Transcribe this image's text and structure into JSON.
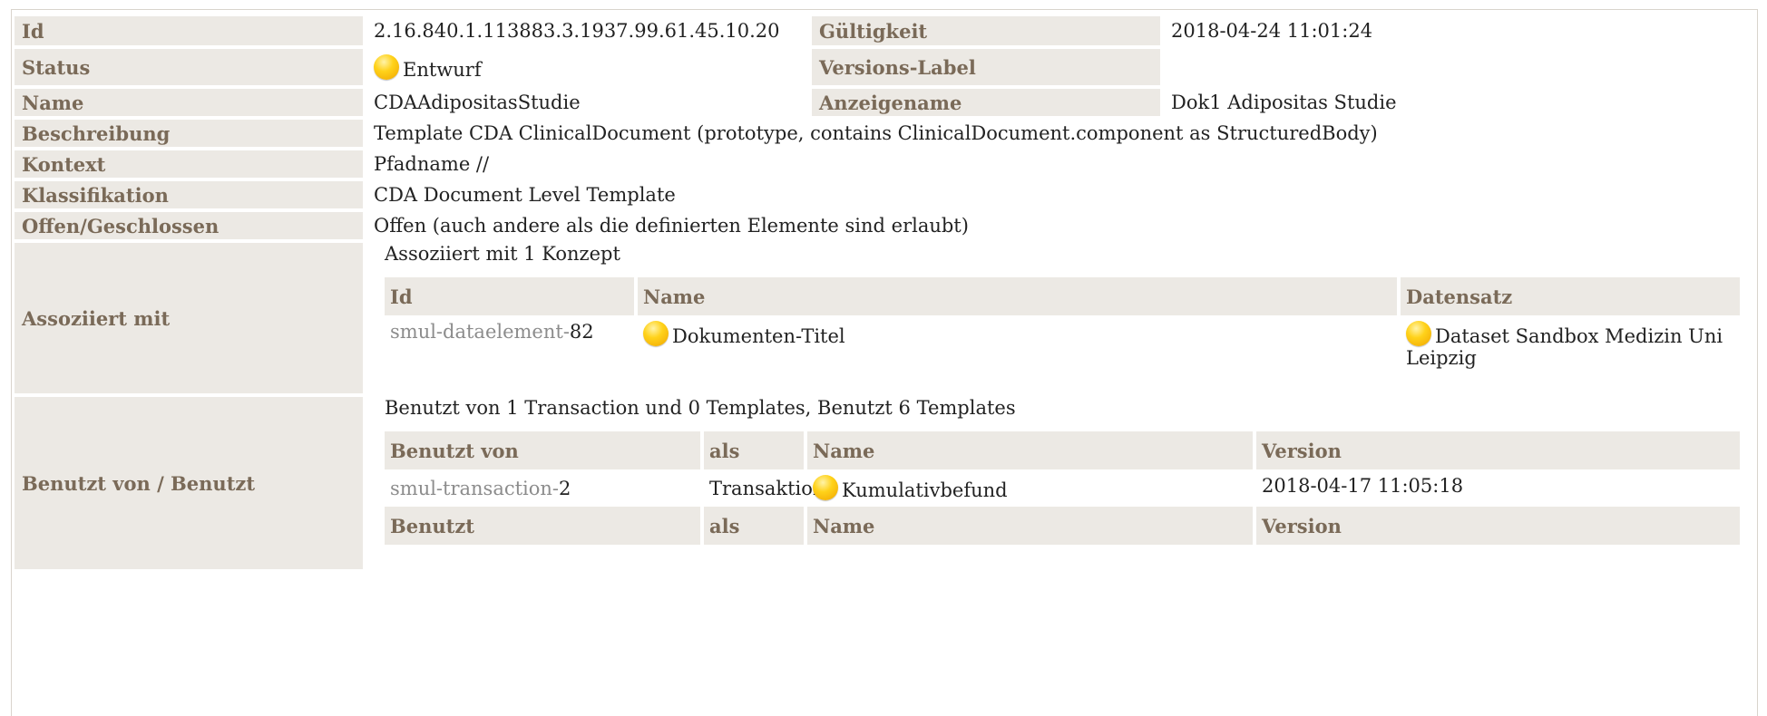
{
  "rows": {
    "id": {
      "label": "Id",
      "value": "2.16.840.1.113883.3.1937.99.61.45.10.20"
    },
    "gueltigkeit": {
      "label": "Gültigkeit",
      "value": "2018-04-24 11:01:24"
    },
    "status": {
      "label": "Status",
      "value": "Entwurf"
    },
    "versions_label": {
      "label": "Versions-Label",
      "value": ""
    },
    "name": {
      "label": "Name",
      "value": "CDAAdipositasStudie"
    },
    "anzeigename": {
      "label": "Anzeigename",
      "value": "Dok1 Adipositas Studie"
    },
    "beschreibung": {
      "label": "Beschreibung",
      "value": "Template CDA ClinicalDocument (prototype, contains ClinicalDocument.component as StructuredBody)"
    },
    "kontext": {
      "label": "Kontext",
      "value": "Pfadname //"
    },
    "klassifikation": {
      "label": "Klassifikation",
      "value": "CDA Document Level Template"
    },
    "offen": {
      "label": "Offen/Geschlossen",
      "value": "Offen (auch andere als die definierten Elemente sind erlaubt)"
    }
  },
  "assoziiert": {
    "label": "Assoziiert mit",
    "title": "Assoziiert mit 1 Konzept",
    "headers": {
      "id": "Id",
      "name": "Name",
      "datensatz": "Datensatz"
    },
    "row": {
      "id_prefix": "smul-dataelement-",
      "id_num": "82",
      "name": "Dokumenten-Titel",
      "dataset": "Dataset Sandbox Medizin Uni Leipzig"
    }
  },
  "benutzt": {
    "label": "Benutzt von / Benutzt",
    "title": "Benutzt von 1 Transaction und 0 Templates, Benutzt 6 Templates",
    "headers_von": {
      "benutzt_von": "Benutzt von",
      "als": "als",
      "name": "Name",
      "version": "Version"
    },
    "row": {
      "id_prefix": "smul-transaction-",
      "id_num": "2",
      "als": "Transaktion",
      "name": "Kumulativbefund",
      "version": "2018-04-17 11:05:18"
    },
    "headers_benutzt": {
      "benutzt": "Benutzt",
      "als": "als",
      "name": "Name",
      "version": "Version"
    }
  },
  "colors": {
    "status_dot": "#ffd21a",
    "label_bg": "#ece9e4",
    "label_text": "#7a6a58"
  }
}
